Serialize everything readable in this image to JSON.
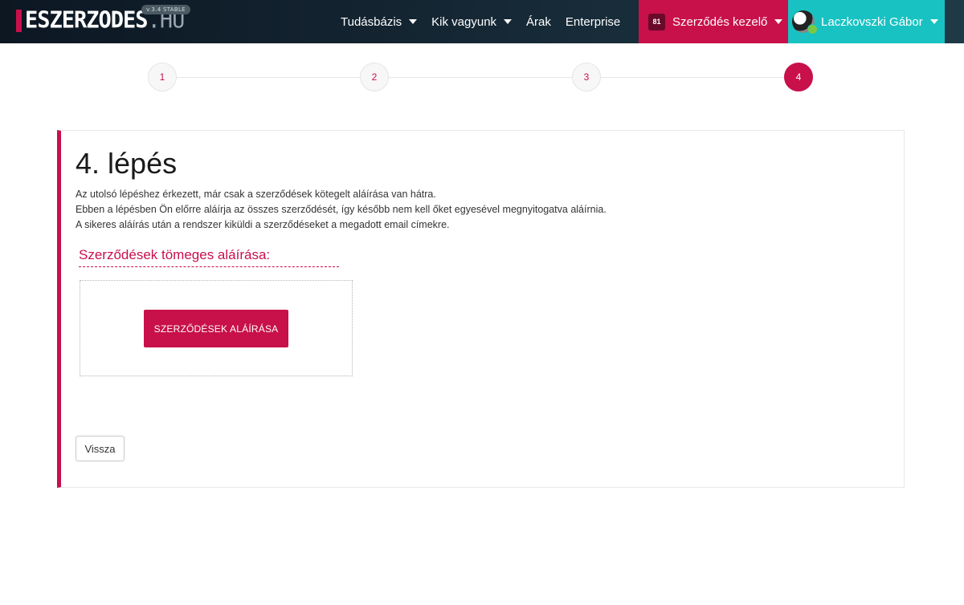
{
  "header": {
    "brand_main": "ESZERZODES",
    "brand_suffix": ".HU",
    "version": "v.3.4 STABLE",
    "nav": [
      {
        "label": "Tudásbázis"
      },
      {
        "label": "Kik vagyunk"
      },
      {
        "label": "Árak"
      },
      {
        "label": "Enterprise"
      }
    ],
    "contracts_menu": {
      "count": "81",
      "label": "Szerződés kezelő"
    },
    "user": {
      "name": "Laczkovszki Gábor"
    }
  },
  "stepper": {
    "steps": [
      "1",
      "2",
      "3",
      "4"
    ],
    "active_step": 4
  },
  "content": {
    "title": "4. lépés",
    "lines": [
      "Az utolsó lépéshez érkezett, már csak a szerződések kötegelt aláírása van hátra.",
      "Ebben a lépésben Ön előrre aláírja az összes szerződését, így később nem kell őket egyesével megnyitogatva aláírnia.",
      "A sikeres aláírás után a rendszer kiküldi a szerződéseket a megadott email címekre."
    ],
    "section_title": "Szerződések tömeges aláírása:",
    "sign_button": "SZERZŐDÉSEK ALÁÍRÁSA",
    "back_button": "Vissza"
  },
  "colors": {
    "accent": "#c8104b",
    "user_bg": "#19c2c2",
    "navbar_bg": "#0c1722"
  }
}
